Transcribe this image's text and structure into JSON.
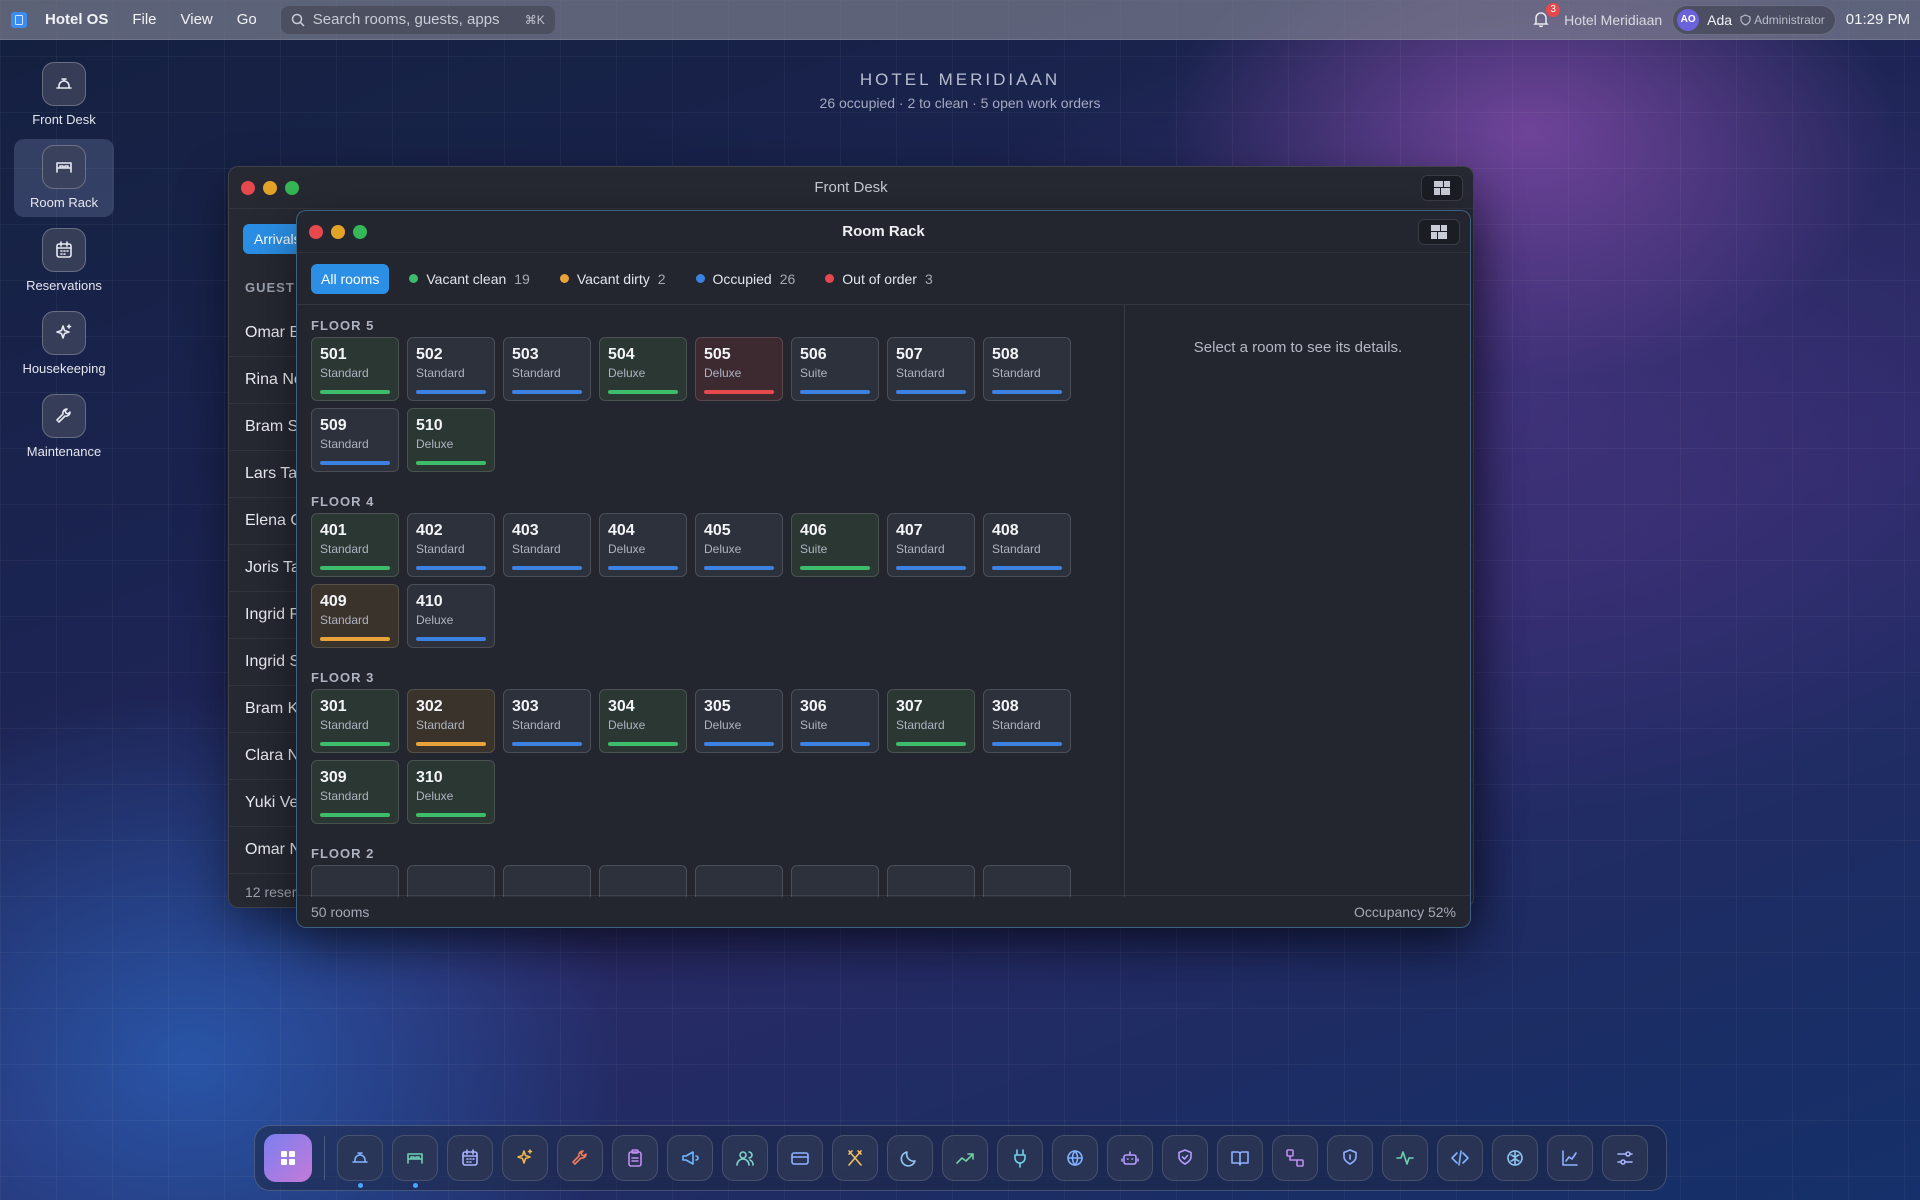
{
  "menubar": {
    "app_name": "Hotel OS",
    "menus": [
      "File",
      "View",
      "Go"
    ],
    "search_placeholder": "Search rooms, guests, apps",
    "search_shortcut": "⌘K",
    "notification_count": "3",
    "hotel_name": "Hotel Meridiaan",
    "user_initials": "AO",
    "user_name": "Ada",
    "user_role": "Administrator",
    "clock": "01:29 PM"
  },
  "desktop": {
    "title": "HOTEL MERIDIAAN",
    "subtitle": "26 occupied · 2 to clean · 5 open work orders"
  },
  "left_dock": [
    {
      "label": "Front Desk",
      "icon": "bell-icon"
    },
    {
      "label": "Room Rack",
      "icon": "bed-icon",
      "active": true
    },
    {
      "label": "Reservations",
      "icon": "calendar-icon"
    },
    {
      "label": "Housekeeping",
      "icon": "sparkles-icon"
    },
    {
      "label": "Maintenance",
      "icon": "wrench-icon"
    }
  ],
  "front_desk": {
    "title": "Front Desk",
    "tab_label": "Arrivals",
    "column_header": "GUEST",
    "rows": [
      "Omar B",
      "Rina No",
      "Bram S",
      "Lars Ta",
      "Elena C",
      "Joris Ta",
      "Ingrid R",
      "Ingrid S",
      "Bram K",
      "Clara N",
      "Yuki Ve",
      "Omar N"
    ],
    "footer": "12 reser"
  },
  "room_rack": {
    "title": "Room Rack",
    "filters": [
      {
        "label": "All rooms",
        "active": true
      },
      {
        "label": "Vacant clean",
        "count": "19",
        "color": "#3dbd6a"
      },
      {
        "label": "Vacant dirty",
        "count": "2",
        "color": "#e8a23a"
      },
      {
        "label": "Occupied",
        "count": "26",
        "color": "#3b82e0"
      },
      {
        "label": "Out of order",
        "count": "3",
        "color": "#e5484d"
      }
    ],
    "status_colors": {
      "clean": "#3dbd6a",
      "dirty": "#e8a23a",
      "occupied": "#3b82e0",
      "ooo": "#e5484d"
    },
    "floors": [
      {
        "label": "FLOOR 5",
        "rooms": [
          {
            "num": "501",
            "type": "Standard",
            "status": "clean"
          },
          {
            "num": "502",
            "type": "Standard",
            "status": "occupied"
          },
          {
            "num": "503",
            "type": "Standard",
            "status": "occupied"
          },
          {
            "num": "504",
            "type": "Deluxe",
            "status": "clean"
          },
          {
            "num": "505",
            "type": "Deluxe",
            "status": "ooo"
          },
          {
            "num": "506",
            "type": "Suite",
            "status": "occupied"
          },
          {
            "num": "507",
            "type": "Standard",
            "status": "occupied"
          },
          {
            "num": "508",
            "type": "Standard",
            "status": "occupied"
          },
          {
            "num": "509",
            "type": "Standard",
            "status": "occupied"
          },
          {
            "num": "510",
            "type": "Deluxe",
            "status": "clean"
          }
        ]
      },
      {
        "label": "FLOOR 4",
        "rooms": [
          {
            "num": "401",
            "type": "Standard",
            "status": "clean"
          },
          {
            "num": "402",
            "type": "Standard",
            "status": "occupied"
          },
          {
            "num": "403",
            "type": "Standard",
            "status": "occupied"
          },
          {
            "num": "404",
            "type": "Deluxe",
            "status": "occupied"
          },
          {
            "num": "405",
            "type": "Deluxe",
            "status": "occupied"
          },
          {
            "num": "406",
            "type": "Suite",
            "status": "clean"
          },
          {
            "num": "407",
            "type": "Standard",
            "status": "occupied"
          },
          {
            "num": "408",
            "type": "Standard",
            "status": "occupied"
          },
          {
            "num": "409",
            "type": "Standard",
            "status": "dirty"
          },
          {
            "num": "410",
            "type": "Deluxe",
            "status": "occupied"
          }
        ]
      },
      {
        "label": "FLOOR 3",
        "rooms": [
          {
            "num": "301",
            "type": "Standard",
            "status": "clean"
          },
          {
            "num": "302",
            "type": "Standard",
            "status": "dirty"
          },
          {
            "num": "303",
            "type": "Standard",
            "status": "occupied"
          },
          {
            "num": "304",
            "type": "Deluxe",
            "status": "clean"
          },
          {
            "num": "305",
            "type": "Deluxe",
            "status": "occupied"
          },
          {
            "num": "306",
            "type": "Suite",
            "status": "occupied"
          },
          {
            "num": "307",
            "type": "Standard",
            "status": "clean"
          },
          {
            "num": "308",
            "type": "Standard",
            "status": "occupied"
          },
          {
            "num": "309",
            "type": "Standard",
            "status": "clean"
          },
          {
            "num": "310",
            "type": "Deluxe",
            "status": "clean"
          }
        ]
      },
      {
        "label": "FLOOR 2",
        "rooms": [
          {
            "num": "",
            "type": "",
            "status": "occupied"
          },
          {
            "num": "",
            "type": "",
            "status": "occupied"
          },
          {
            "num": "",
            "type": "",
            "status": "occupied"
          },
          {
            "num": "",
            "type": "",
            "status": "occupied"
          },
          {
            "num": "",
            "type": "",
            "status": "occupied"
          },
          {
            "num": "",
            "type": "",
            "status": "occupied"
          },
          {
            "num": "",
            "type": "",
            "status": "occupied"
          },
          {
            "num": "",
            "type": "",
            "status": "occupied"
          }
        ]
      }
    ],
    "detail_placeholder": "Select a room to see its details.",
    "footer_left": "50 rooms",
    "footer_right": "Occupancy 52%"
  },
  "dock": [
    {
      "icon": "grid-icon",
      "launcher": true
    },
    {
      "icon": "bell-icon",
      "running": true
    },
    {
      "icon": "bed-icon",
      "running": true
    },
    {
      "icon": "calendar-icon"
    },
    {
      "icon": "sparkles-icon"
    },
    {
      "icon": "wrench-icon"
    },
    {
      "icon": "clipboard-icon"
    },
    {
      "icon": "megaphone-icon"
    },
    {
      "icon": "users-icon"
    },
    {
      "icon": "credit-card-icon"
    },
    {
      "icon": "utensils-icon"
    },
    {
      "icon": "moon-icon"
    },
    {
      "icon": "trending-up-icon"
    },
    {
      "icon": "plug-icon"
    },
    {
      "icon": "globe-icon"
    },
    {
      "icon": "bot-icon"
    },
    {
      "icon": "shield-check-icon"
    },
    {
      "icon": "book-icon"
    },
    {
      "icon": "workflow-icon"
    },
    {
      "icon": "shield-icon"
    },
    {
      "icon": "activity-icon"
    },
    {
      "icon": "code-icon"
    },
    {
      "icon": "brain-icon"
    },
    {
      "icon": "chart-icon"
    },
    {
      "icon": "sliders-icon"
    }
  ]
}
